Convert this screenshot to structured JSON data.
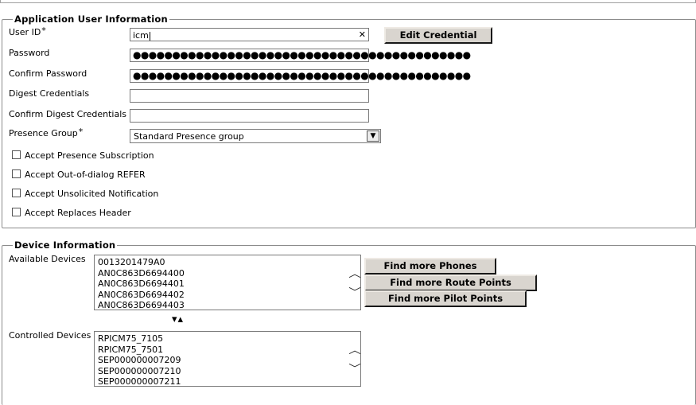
{
  "app_user": {
    "legend": "Application User Information",
    "user_id_label": "User ID",
    "user_id_value": "icm",
    "clear_glyph": "✕",
    "edit_credential_label": "Edit Credential",
    "password_label": "Password",
    "password_value": "●●●●●●●●●●●●●●●●●●●●●●●●●●●●●●●●●●●●●●●●●●●",
    "confirm_password_label": "Confirm Password",
    "confirm_password_value": "●●●●●●●●●●●●●●●●●●●●●●●●●●●●●●●●●●●●●●●●●●●",
    "digest_label": "Digest Credentials",
    "confirm_digest_label": "Confirm Digest Credentials",
    "presence_group_label": "Presence Group",
    "presence_group_value": "Standard Presence group",
    "required_mark": "*",
    "checkboxes": [
      {
        "label": "Accept Presence Subscription",
        "checked": false
      },
      {
        "label": "Accept Out-of-dialog REFER",
        "checked": false
      },
      {
        "label": "Accept Unsolicited Notification",
        "checked": false
      },
      {
        "label": "Accept Replaces Header",
        "checked": false
      }
    ]
  },
  "device": {
    "legend": "Device Information",
    "available_label": "Available Devices",
    "available_items": [
      "0013201479A0",
      "AN0C863D6694400",
      "AN0C863D6694401",
      "AN0C863D6694402",
      "AN0C863D6694403"
    ],
    "find_phones_label": "Find more Phones",
    "find_route_points_label": "Find more Route Points",
    "find_pilot_points_label": "Find more Pilot Points",
    "move_arrows": "⌄⌃",
    "controlled_label": "Controlled Devices",
    "controlled_items": [
      "RPICM75_7105",
      "RPICM75_7501",
      "SEP000000007209",
      "SEP000000007210",
      "SEP000000007211"
    ]
  }
}
